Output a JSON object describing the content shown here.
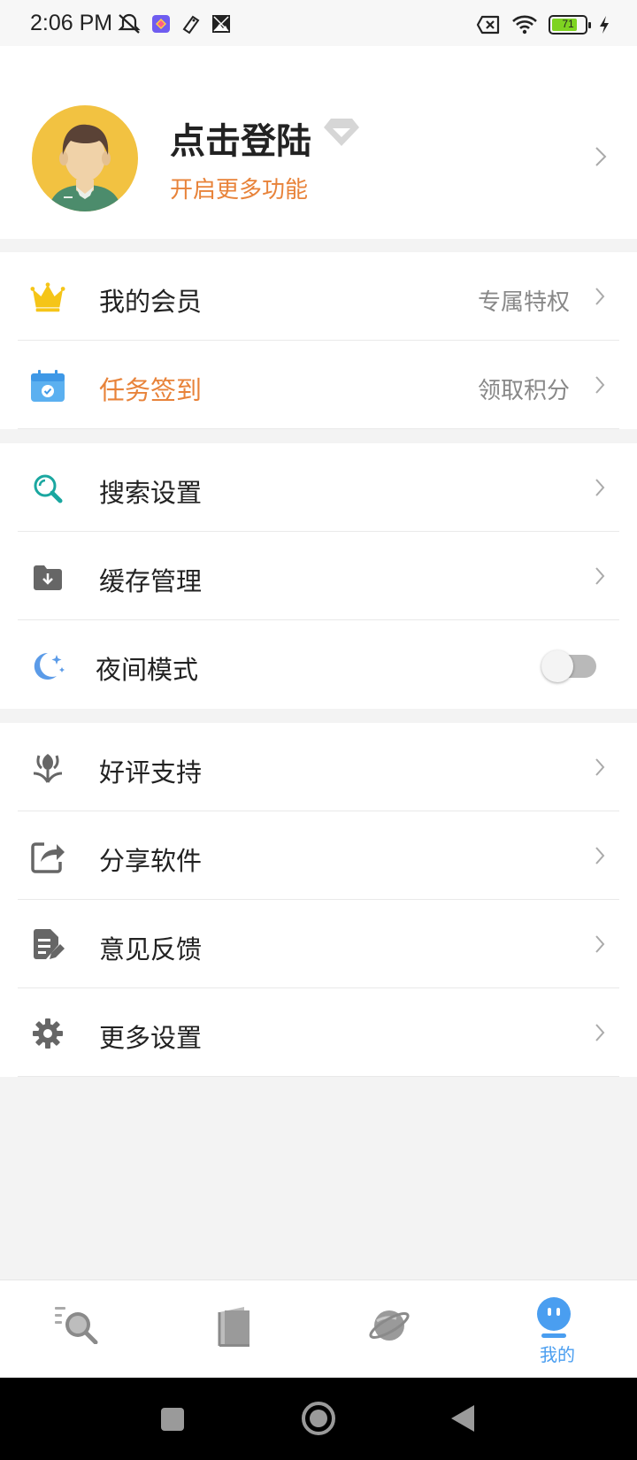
{
  "status_bar": {
    "time": "2:06 PM",
    "battery_level": "71",
    "battery_fraction": 0.71,
    "icons_left": [
      "muted-bell-icon",
      "app-icon",
      "tag-icon",
      "image-icon"
    ],
    "icons_right": [
      "no-sim-icon",
      "wifi-icon",
      "battery-icon",
      "charging-icon"
    ]
  },
  "profile": {
    "name": "点击登陆",
    "subtitle": "开启更多功能",
    "avatar_icon": "user-avatar",
    "badge_icon": "diamond-icon",
    "subtitle_color": "#e8833a"
  },
  "menu_sections": [
    {
      "items": [
        {
          "label": "我的会员",
          "value": "专属特权",
          "icon": "crown-icon",
          "icon_color": "#f5c518"
        },
        {
          "label": "任务签到",
          "value": "领取积分",
          "icon": "calendar-check-icon",
          "icon_color": "#5bb0f0",
          "label_color": "#e8833a"
        }
      ]
    },
    {
      "items": [
        {
          "label": "搜索设置",
          "icon": "search-icon",
          "icon_color": "#1aa7a0"
        },
        {
          "label": "缓存管理",
          "icon": "folder-download-icon",
          "icon_color": "#666666"
        },
        {
          "label": "夜间模式",
          "icon": "moon-icon",
          "icon_color": "#5b9be8",
          "toggle": false
        }
      ]
    },
    {
      "items": [
        {
          "label": "好评支持",
          "icon": "flower-icon",
          "icon_color": "#666666"
        },
        {
          "label": "分享软件",
          "icon": "share-icon",
          "icon_color": "#666666"
        },
        {
          "label": "意见反馈",
          "icon": "feedback-icon",
          "icon_color": "#666666"
        },
        {
          "label": "更多设置",
          "icon": "gear-icon",
          "icon_color": "#666666"
        }
      ]
    }
  ],
  "tab_bar": {
    "tabs": [
      {
        "icon": "discover-search-icon",
        "active": false
      },
      {
        "icon": "bookshelf-icon",
        "active": false
      },
      {
        "icon": "planet-icon",
        "active": false
      },
      {
        "icon": "profile-face-icon",
        "label": "我的",
        "active": true
      }
    ],
    "active_color": "#4a9ef0",
    "inactive_color": "#8a8a8a"
  },
  "nav_bar": {
    "buttons": [
      "recents-button",
      "home-button",
      "back-button"
    ]
  }
}
